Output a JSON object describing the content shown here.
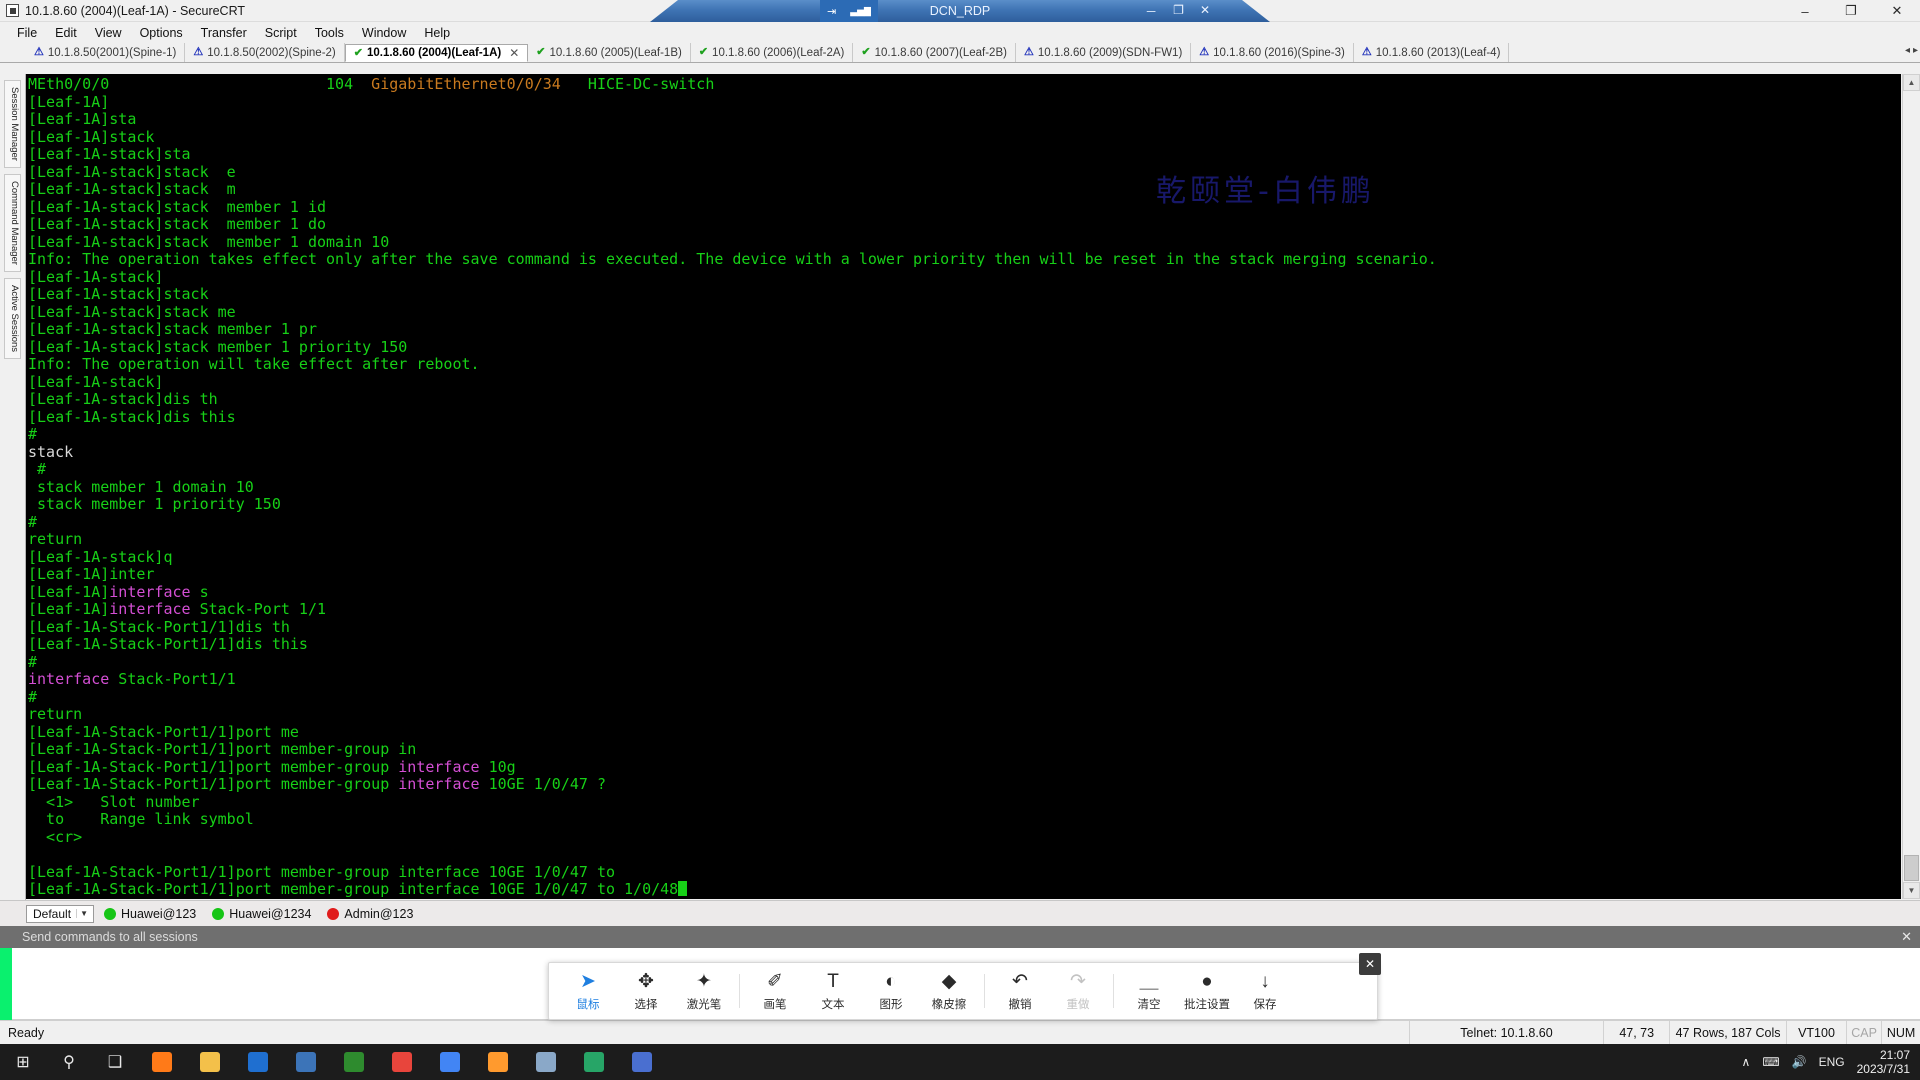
{
  "window": {
    "title": "10.1.8.60 (2004)(Leaf-1A) - SecureCRT",
    "minimize": "–",
    "maximize": "❐",
    "close": "✕"
  },
  "menubar": [
    "File",
    "Edit",
    "View",
    "Options",
    "Transfer",
    "Script",
    "Tools",
    "Window",
    "Help"
  ],
  "left_rail": [
    "Session Manager",
    "Command Manager",
    "Active Sessions"
  ],
  "tabs": [
    {
      "label": "10.1.8.50(2001)(Spine-1)",
      "status": "warning",
      "active": false
    },
    {
      "label": "10.1.8.50(2002)(Spine-2)",
      "status": "warning",
      "active": false
    },
    {
      "label": "10.1.8.60 (2004)(Leaf-1A)",
      "status": "ok",
      "active": true
    },
    {
      "label": "10.1.8.60 (2005)(Leaf-1B)",
      "status": "ok",
      "active": false
    },
    {
      "label": "10.1.8.60 (2006)(Leaf-2A)",
      "status": "ok",
      "active": false
    },
    {
      "label": "10.1.8.60 (2007)(Leaf-2B)",
      "status": "ok",
      "active": false
    },
    {
      "label": "10.1.8.60 (2009)(SDN-FW1)",
      "status": "warning",
      "active": false
    },
    {
      "label": "10.1.8.60 (2016)(Spine-3)",
      "status": "warning",
      "active": false
    },
    {
      "label": "10.1.8.60 (2013)(Leaf-4)",
      "status": "warning",
      "active": false
    }
  ],
  "terminal": {
    "watermark": "乾颐堂-白伟鹏",
    "lines": [
      [
        {
          "t": "MEth0/0/0                        ",
          "c": "grn"
        },
        {
          "t": "104  ",
          "c": "grn"
        },
        {
          "t": "GigabitEthernet0/0/34",
          "c": "org"
        },
        {
          "t": "   HICE-DC-switch",
          "c": "grn"
        }
      ],
      [
        {
          "t": "[Leaf-1A]",
          "c": "grn"
        }
      ],
      [
        {
          "t": "[Leaf-1A]sta",
          "c": "grn"
        }
      ],
      [
        {
          "t": "[Leaf-1A]stack",
          "c": "grn"
        }
      ],
      [
        {
          "t": "[Leaf-1A-stack]sta",
          "c": "grn"
        }
      ],
      [
        {
          "t": "[Leaf-1A-stack]stack  e",
          "c": "grn"
        }
      ],
      [
        {
          "t": "[Leaf-1A-stack]stack  m",
          "c": "grn"
        }
      ],
      [
        {
          "t": "[Leaf-1A-stack]stack  member 1 id",
          "c": "grn"
        }
      ],
      [
        {
          "t": "[Leaf-1A-stack]stack  member 1 do",
          "c": "grn"
        }
      ],
      [
        {
          "t": "[Leaf-1A-stack]stack  member 1 domain 10",
          "c": "grn"
        }
      ],
      [
        {
          "t": "Info: The operation takes effect only after the save command is executed. The device with a lower priority then will be reset in the stack merging scenario.",
          "c": "grn"
        }
      ],
      [
        {
          "t": "[Leaf-1A-stack]",
          "c": "grn"
        }
      ],
      [
        {
          "t": "[Leaf-1A-stack]stack",
          "c": "grn"
        }
      ],
      [
        {
          "t": "[Leaf-1A-stack]stack me",
          "c": "grn"
        }
      ],
      [
        {
          "t": "[Leaf-1A-stack]stack member 1 pr",
          "c": "grn"
        }
      ],
      [
        {
          "t": "[Leaf-1A-stack]stack member 1 priority 150",
          "c": "grn"
        }
      ],
      [
        {
          "t": "Info: The operation will take effect after reboot.",
          "c": "grn"
        }
      ],
      [
        {
          "t": "[Leaf-1A-stack]",
          "c": "grn"
        }
      ],
      [
        {
          "t": "[Leaf-1A-stack]dis th",
          "c": "grn"
        }
      ],
      [
        {
          "t": "[Leaf-1A-stack]dis this",
          "c": "grn"
        }
      ],
      [
        {
          "t": "#",
          "c": "grn"
        }
      ],
      [
        {
          "t": "stack",
          "c": "wht"
        }
      ],
      [
        {
          "t": " #",
          "c": "grn"
        }
      ],
      [
        {
          "t": " stack member 1 domain 10",
          "c": "grn"
        }
      ],
      [
        {
          "t": " stack member 1 priority 150",
          "c": "grn"
        }
      ],
      [
        {
          "t": "#",
          "c": "grn"
        }
      ],
      [
        {
          "t": "return",
          "c": "grn"
        }
      ],
      [
        {
          "t": "[Leaf-1A-stack]q",
          "c": "grn"
        }
      ],
      [
        {
          "t": "[Leaf-1A]inter",
          "c": "grn"
        }
      ],
      [
        {
          "t": "[Leaf-1A]",
          "c": "grn"
        },
        {
          "t": "interface",
          "c": "mag"
        },
        {
          "t": " s",
          "c": "grn"
        }
      ],
      [
        {
          "t": "[Leaf-1A]",
          "c": "grn"
        },
        {
          "t": "interface",
          "c": "mag"
        },
        {
          "t": " Stack-Port 1/1",
          "c": "grn"
        }
      ],
      [
        {
          "t": "[Leaf-1A-Stack-Port1/1]dis th",
          "c": "grn"
        }
      ],
      [
        {
          "t": "[Leaf-1A-Stack-Port1/1]dis this",
          "c": "grn"
        }
      ],
      [
        {
          "t": "#",
          "c": "grn"
        }
      ],
      [
        {
          "t": "interface",
          "c": "mag"
        },
        {
          "t": " Stack-Port1/1",
          "c": "grn"
        }
      ],
      [
        {
          "t": "#",
          "c": "grn"
        }
      ],
      [
        {
          "t": "return",
          "c": "grn"
        }
      ],
      [
        {
          "t": "[Leaf-1A-Stack-Port1/1]port me",
          "c": "grn"
        }
      ],
      [
        {
          "t": "[Leaf-1A-Stack-Port1/1]port member-group in",
          "c": "grn"
        }
      ],
      [
        {
          "t": "[Leaf-1A-Stack-Port1/1]port member-group ",
          "c": "grn"
        },
        {
          "t": "interface",
          "c": "mag"
        },
        {
          "t": " 10g",
          "c": "grn"
        }
      ],
      [
        {
          "t": "[Leaf-1A-Stack-Port1/1]port member-group ",
          "c": "grn"
        },
        {
          "t": "interface",
          "c": "mag"
        },
        {
          "t": " 10GE 1/0/47 ?",
          "c": "grn"
        }
      ],
      [
        {
          "t": "  <1>   Slot number",
          "c": "grn"
        }
      ],
      [
        {
          "t": "  to    Range link symbol",
          "c": "grn"
        }
      ],
      [
        {
          "t": "  <cr>",
          "c": "grn"
        }
      ],
      [
        {
          "t": "",
          "c": "grn"
        }
      ],
      [
        {
          "t": "[Leaf-1A-Stack-Port1/1]port member-group interface 10GE 1/0/47 to",
          "c": "grn"
        }
      ],
      [
        {
          "t": "[Leaf-1A-Stack-Port1/1]port member-group interface 10GE 1/0/47 to 1/0/48",
          "c": "grn"
        },
        {
          "t": "CURSOR",
          "c": "cur"
        }
      ]
    ]
  },
  "command_bar": {
    "profile": "Default",
    "credentials": [
      {
        "label": "Huawei@123",
        "color": "#16c516"
      },
      {
        "label": "Huawei@1234",
        "color": "#16c516"
      },
      {
        "label": "Admin@123",
        "color": "#e01b1b"
      }
    ]
  },
  "send_bar": {
    "label": "Send commands to all sessions",
    "close": "✕",
    "input_value": ""
  },
  "status_bar": {
    "ready": "Ready",
    "connection": "Telnet: 10.1.8.60",
    "cursor_pos": "47, 73",
    "dimensions": "47 Rows, 187 Cols",
    "emulation": "VT100",
    "cap": "CAP",
    "num": "NUM"
  },
  "rdp_bar": {
    "title": "DCN_RDP",
    "pin_icon": "⇥",
    "signal_icon": "▃▅▇",
    "minimize": "－",
    "restore": "❐",
    "close": "✕"
  },
  "annotation_toolbar": {
    "close": "✕",
    "tools": [
      {
        "label": "鼠标",
        "icon": "cursor-arrow",
        "glyph": "➤",
        "state": "active"
      },
      {
        "label": "选择",
        "icon": "move-select",
        "glyph": "✥",
        "state": "normal"
      },
      {
        "label": "激光笔",
        "icon": "laser-pen",
        "glyph": "✦",
        "state": "normal"
      },
      {
        "label": "画笔",
        "icon": "brush",
        "glyph": "✐",
        "state": "normal"
      },
      {
        "label": "文本",
        "icon": "text",
        "glyph": "T",
        "state": "normal"
      },
      {
        "label": "图形",
        "icon": "shape",
        "glyph": "◐",
        "state": "normal"
      },
      {
        "label": "橡皮擦",
        "icon": "eraser",
        "glyph": "◆",
        "state": "normal"
      },
      {
        "label": "撤销",
        "icon": "undo",
        "glyph": "↶",
        "state": "normal"
      },
      {
        "label": "重做",
        "icon": "redo",
        "glyph": "↷",
        "state": "disabled"
      },
      {
        "label": "清空",
        "icon": "trash",
        "glyph": "＿",
        "state": "normal"
      },
      {
        "label": "批注设置",
        "icon": "annotation-settings",
        "glyph": "●",
        "state": "normal"
      },
      {
        "label": "保存",
        "icon": "save-download",
        "glyph": "↓",
        "state": "normal"
      }
    ]
  },
  "taskbar": {
    "start": "⊞",
    "search": "⚲",
    "taskview": "❑",
    "apps": [
      {
        "name": "firefox",
        "color": "#ff7a18"
      },
      {
        "name": "file-explorer",
        "color": "#f3c04a"
      },
      {
        "name": "browser-dark",
        "color": "#1f6fd0"
      },
      {
        "name": "folder-blue",
        "color": "#3c74b8"
      },
      {
        "name": "securecrt",
        "color": "#2e8b2e"
      },
      {
        "name": "chrome",
        "color": "#e8453c"
      },
      {
        "name": "chrome-2",
        "color": "#4285f4"
      },
      {
        "name": "firefox-2",
        "color": "#ff9a2e"
      },
      {
        "name": "rdp",
        "color": "#8aa8c8"
      },
      {
        "name": "notes",
        "color": "#27a567"
      },
      {
        "name": "teams",
        "color": "#4a6fd0"
      }
    ],
    "tray": {
      "chevron": "∧",
      "network": "⌨",
      "volume": "🔊",
      "lang": "ENG",
      "time": "21:07",
      "date": "2023/7/31"
    }
  }
}
